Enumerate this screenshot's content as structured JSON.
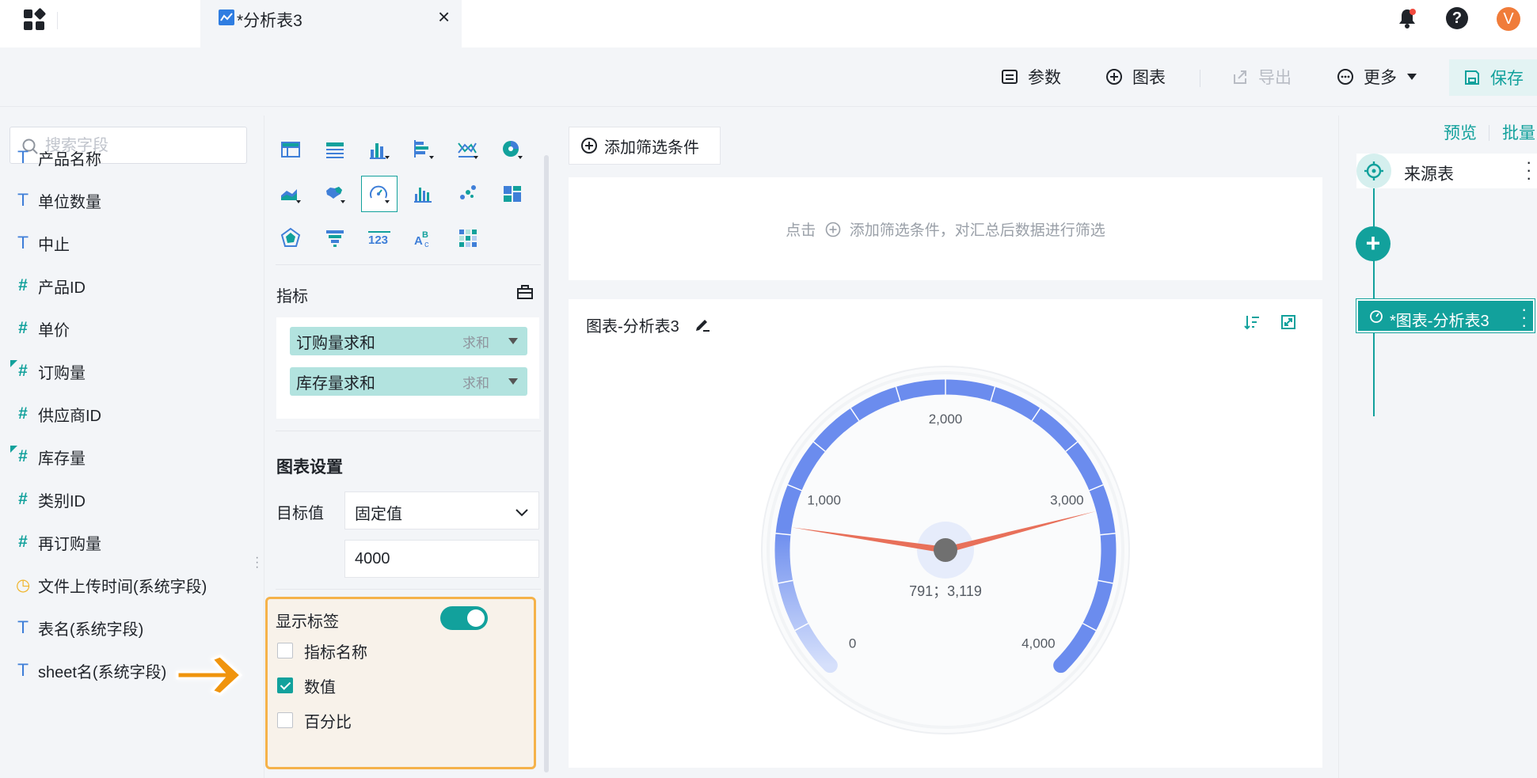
{
  "topbar": {
    "tab_title": "*分析表3",
    "user_initial": "V"
  },
  "toolbar": {
    "params_label": "参数",
    "chart_label": "图表",
    "export_label": "导出",
    "more_label": "更多",
    "save_label": "保存"
  },
  "fields": {
    "search_placeholder": "搜索字段",
    "items": [
      {
        "type": "text",
        "name": "产品名称"
      },
      {
        "type": "text",
        "name": "单位数量"
      },
      {
        "type": "text",
        "name": "中止"
      },
      {
        "type": "number",
        "name": "产品ID"
      },
      {
        "type": "number",
        "name": "单价"
      },
      {
        "type": "number-expr",
        "name": "订购量"
      },
      {
        "type": "number",
        "name": "供应商ID"
      },
      {
        "type": "number-expr",
        "name": "库存量"
      },
      {
        "type": "number",
        "name": "类别ID"
      },
      {
        "type": "number",
        "name": "再订购量"
      },
      {
        "type": "time",
        "name": "文件上传时间(系统字段)"
      },
      {
        "type": "text",
        "name": "表名(系统字段)"
      },
      {
        "type": "text",
        "name": "sheet名(系统字段)"
      }
    ]
  },
  "config": {
    "metrics_label": "指标",
    "metrics": [
      {
        "name": "订购量求和",
        "agg": "求和"
      },
      {
        "name": "库存量求和",
        "agg": "求和"
      }
    ],
    "chart_settings_title": "图表设置",
    "target_label": "目标值",
    "target_mode": "固定值",
    "target_value": "4000",
    "show_labels_label": "显示标签",
    "show_labels_on": true,
    "label_options": [
      {
        "label": "指标名称",
        "checked": false
      },
      {
        "label": "数值",
        "checked": true
      },
      {
        "label": "百分比",
        "checked": false
      }
    ],
    "selected_chart_type": "gauge"
  },
  "filter": {
    "add_button_label": "添加筛选条件",
    "hint_prefix": "点击",
    "hint_suffix": "添加筛选条件，对汇总后数据进行筛选"
  },
  "chart": {
    "title": "图表-分析表3"
  },
  "chart_data": {
    "type": "gauge",
    "min": 0,
    "max": 4000,
    "tick_labels": [
      "0",
      "1,000",
      "2,000",
      "3,000",
      "4,000"
    ],
    "tick_values": [
      0,
      1000,
      2000,
      3000,
      4000
    ],
    "pointers": [
      {
        "name": "订购量求和",
        "value": 791
      },
      {
        "name": "库存量求和",
        "value": 3119
      }
    ],
    "value_label": "791；3,119",
    "colors": {
      "arc": "#6b8cee",
      "arc_fade": "#d6e0fb",
      "pointer": "#e8705a",
      "hub": "#707070"
    }
  },
  "flow": {
    "preview_label": "预览",
    "batch_label": "批量",
    "source_label": "来源表",
    "chart_node_label": "*图表-分析表3"
  },
  "colors": {
    "accent": "#12a19c",
    "highlight_border": "#f5b24a",
    "avatar": "#f07c3a"
  }
}
